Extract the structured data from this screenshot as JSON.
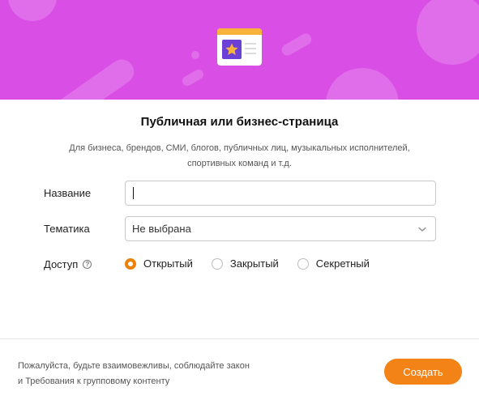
{
  "dialog": {
    "title": "Публичная или бизнес-страница",
    "subtitle_line1": "Для бизнеса, брендов, СМИ, блогов, публичных лиц, музыкальных исполнителей,",
    "subtitle_line2": "спортивных команд и т.д."
  },
  "form": {
    "name_label": "Название",
    "name_value": "",
    "topic_label": "Тематика",
    "topic_selected": "Не выбрана",
    "access_label": "Доступ",
    "access_options": [
      "Открытый",
      "Закрытый",
      "Секретный"
    ],
    "access_selected": "Открытый"
  },
  "footer": {
    "note_line1": "Пожалуйста, будьте взаимовежливы, соблюдайте закон",
    "note_line2": "и Требования к групповому контенту",
    "create_label": "Создать"
  },
  "colors": {
    "hero_bg": "#d94fe6",
    "accent": "#f38316",
    "radio_selected": "#ee8208"
  },
  "icons": [
    "business-page-illustration-icon",
    "star-icon",
    "help-icon",
    "chevron-down-icon"
  ]
}
